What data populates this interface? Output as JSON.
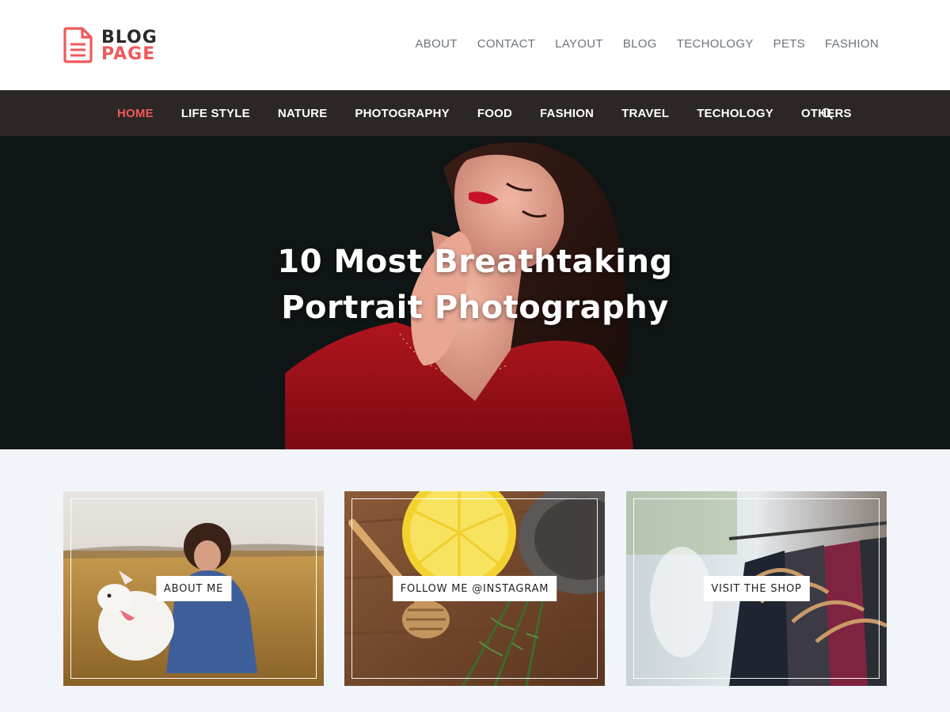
{
  "brand": {
    "word1": "BLOG",
    "word2": "PAGE",
    "accent_color": "#f0595a"
  },
  "top_nav": {
    "items": [
      "ABOUT",
      "CONTACT",
      "LAYOUT",
      "BLOG",
      "TECHOLOGY",
      "PETS",
      "FASHION"
    ]
  },
  "main_nav": {
    "items": [
      "HOME",
      "LIFE STYLE",
      "NATURE",
      "PHOTOGRAPHY",
      "FOOD",
      "FASHION",
      "TRAVEL",
      "TECHOLOGY",
      "OTHERS"
    ],
    "active": "HOME",
    "search_icon": "search-icon",
    "background": "#2c2625"
  },
  "hero": {
    "title_line1": "10 Most Breathtaking",
    "title_line2": "Portrait Photography"
  },
  "cards": [
    {
      "label": "ABOUT ME"
    },
    {
      "label": "FOLLOW ME @INSTAGRAM"
    },
    {
      "label": "VISIT THE SHOP"
    }
  ]
}
